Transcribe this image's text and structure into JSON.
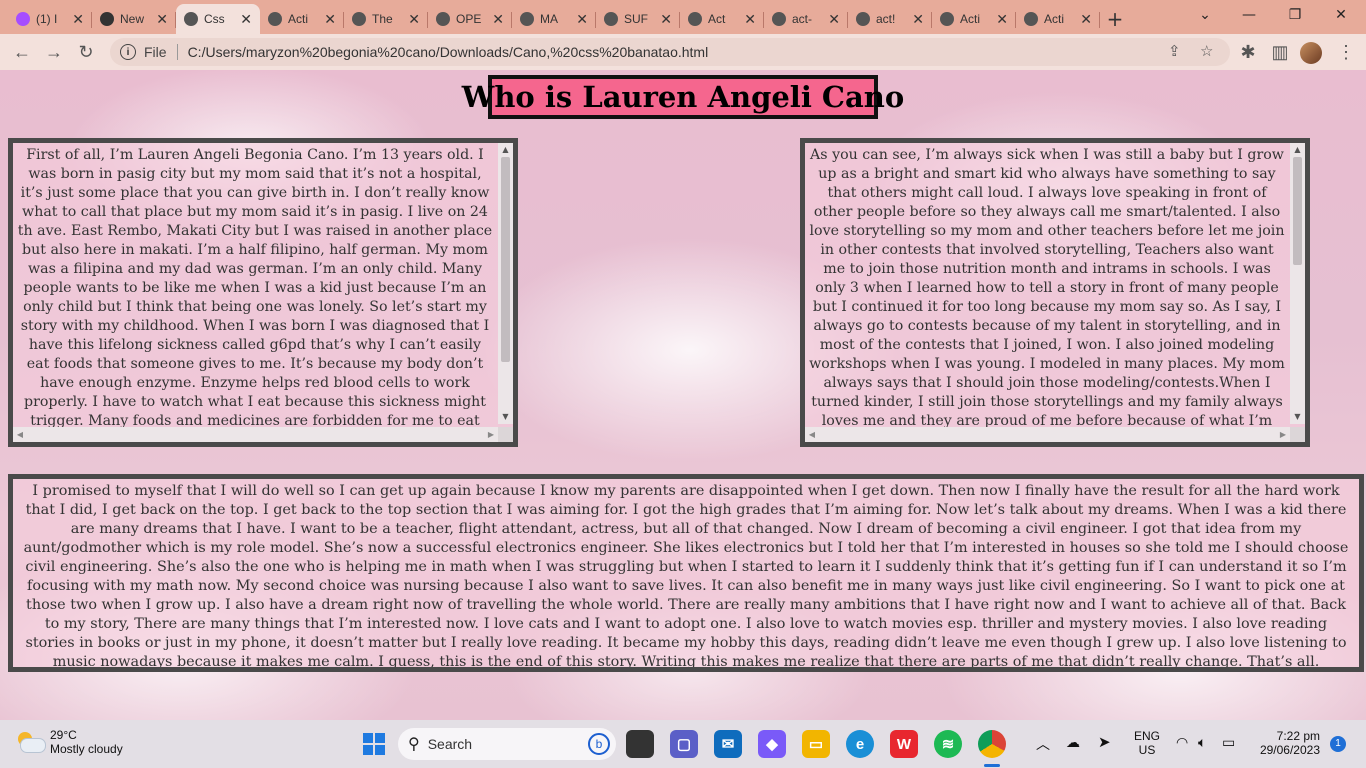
{
  "browser": {
    "tabs": [
      {
        "title": "(1) I",
        "favicon": "messenger-icon",
        "color": "#a64dff"
      },
      {
        "title": "New",
        "favicon": "github-icon",
        "color": "#333333"
      },
      {
        "title": "Css",
        "favicon": "globe-icon",
        "color": "#555555",
        "active": true
      },
      {
        "title": "Acti",
        "favicon": "globe-icon",
        "color": "#555555"
      },
      {
        "title": "The",
        "favicon": "globe-icon",
        "color": "#555555"
      },
      {
        "title": "OPE",
        "favicon": "globe-icon",
        "color": "#555555"
      },
      {
        "title": "MA",
        "favicon": "globe-icon",
        "color": "#555555"
      },
      {
        "title": "SUF",
        "favicon": "globe-icon",
        "color": "#555555"
      },
      {
        "title": "Act",
        "favicon": "globe-icon",
        "color": "#555555"
      },
      {
        "title": "act-",
        "favicon": "globe-icon",
        "color": "#555555"
      },
      {
        "title": "act!",
        "favicon": "globe-icon",
        "color": "#555555"
      },
      {
        "title": "Acti",
        "favicon": "globe-icon",
        "color": "#555555"
      },
      {
        "title": "Acti",
        "favicon": "globe-icon",
        "color": "#555555"
      }
    ],
    "new_tab": "+",
    "address_label": "File",
    "url": "C:/Users/maryzon%20begonia%20cano/Downloads/Cano,%20css%20banatao.html"
  },
  "page": {
    "title": "Who is Lauren Angeli Cano",
    "left_text": "First of all, I’m Lauren Angeli Begonia Cano. I’m 13 years old. I was born in pasig city but my mom said that it’s not a hospital, it’s just some place that you can give birth in. I don’t really know what to call that place but my mom said it’s in pasig. I live on 24 th ave. East Rembo, Makati City but I was raised in another place but also here in makati. I’m a half filipino, half german. My mom was a filipina and my dad was german. I’m an only child. Many people wants to be like me when I was a kid just because I’m an only child but I think that being one was lonely. So let’s start my story with my childhood. When I was born I was diagnosed that I have this lifelong sickness called g6pd that’s why I can’t easily eat foods that someone gives to me. It’s because my body don’t have enough enzyme. Enzyme helps red blood cells to work properly. I have to watch what I eat because this sickness might trigger. Many foods and medicines are forbidden for me to eat and drink because of this sickness. I also have UTI",
    "right_text": "As you can see, I’m always sick when I was still a baby but I grow up as a bright and smart kid who always have something to say that others might call loud. I always love speaking in front of other people before so they always call me smart/talented. I also love storytelling so my mom and other teachers before let me join in other contests that involved storytelling, Teachers also want me to join those nutrition month and intrams in schools. I was only 3 when I learned how to tell a story in front of many people but I continued it for too long because my mom say so. As I say, I always go to contests because of my talent in storytelling, and in most of the contests that I joined, I won. I also joined modeling workshops when I was young. I modeled in many places. My mom always says that I should join those modeling/contests.When I turned kinder, I still join those storytellings and my family always loves me and they are proud of me before because of what I’m doing even our",
    "bottom_text": "I promised to myself that I will do well so I can get up again because I know my parents are disappointed when I get down. Then now I finally have the result for all the hard work that I did, I get back on the top. I get back to the top section that I was aiming for. I got the high grades that I’m aiming for. Now let’s talk about my dreams. When I was a kid there are many dreams that I have. I want to be a teacher, flight attendant, actress, but all of that changed. Now I dream of becoming a civil engineer. I got that idea from my aunt/godmother which is my role model. She’s now a successful electronics engineer. She likes electronics but I told her that I’m interested in houses so she told me I should choose civil engineering. She’s also the one who is helping me in math when I was struggling but when I started to learn it I suddenly think that it’s getting fun if I can understand it so I’m focusing with my math now. My second choice was nursing because I also want to save lives. It can also benefit me in many ways just like civil engineering. So I want to pick one at those two when I grow up. I also have a dream right now of travelling the whole world. There are really many ambitions that I have right now and I want to achieve all of that. Back to my story, There are many things that I’m interested now. I love cats and I want to adopt one. I also love to watch movies esp. thriller and mystery movies. I also love reading stories in books or just in my phone, it doesn’t matter but I really love reading. It became my hobby this days, reading didn’t leave me even though I grew up. I also love listening to music nowadays because it makes me calm. I guess, this is the end of this story. Writing this makes me realize that there are parts of me that didn’t really change. That’s all."
  },
  "taskbar": {
    "weather_temp": "29°C",
    "weather_desc": "Mostly cloudy",
    "search_placeholder": "Search",
    "language": "ENG",
    "region": "US",
    "time": "7:22 pm",
    "date": "29/06/2023",
    "notification_count": "1"
  },
  "colors": {
    "tab_bar": "#e7ab9a",
    "title_bg": "#f5668e",
    "box_border": "#4a4a4a"
  }
}
